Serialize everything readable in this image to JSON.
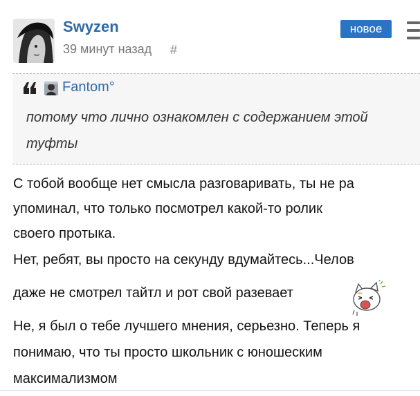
{
  "post": {
    "author": "Swyzen",
    "time": "39 минут назад",
    "permalink": "#",
    "badge": "новое"
  },
  "quote": {
    "author": "Fantom°",
    "lines": [
      "потому что лично ознакомлен с содержанием этой",
      "туфты"
    ]
  },
  "body": {
    "lines": [
      "С тобой вообще нет смысла разговаривать, ты не ра",
      "упоминал, что только посмотрел какой-то ролик",
      "своего протыка.",
      "Нет, ребят, вы просто на секунду вдумайтесь...Челов",
      "даже не смотрел тайтл и рот свой разевает",
      "Не, я был о тебе лучшего мнения, серьезно. Теперь я",
      "понимаю, что ты просто школьник с юношеским",
      "максимализмом"
    ]
  },
  "icons": {
    "menu": "hamburger-menu-icon",
    "quote": "quote-marks-icon",
    "emoji": "shouting-cat-emoji"
  },
  "colors": {
    "author": "#2f6aa8",
    "badge": "#2b74c3",
    "quote_bg": "#f6f6f6"
  }
}
